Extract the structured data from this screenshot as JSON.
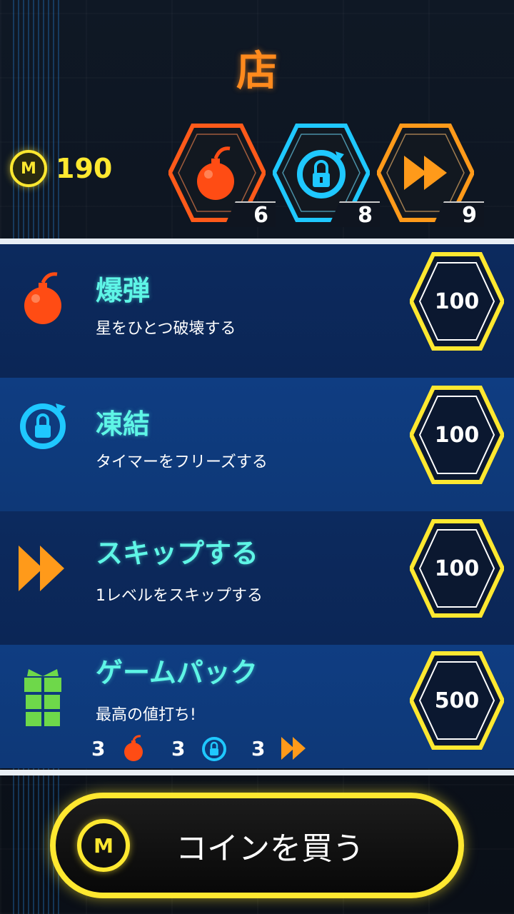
{
  "header": {
    "title": "店",
    "coin_symbol": "M",
    "coin_balance": "190"
  },
  "inventory": [
    {
      "name": "bomb",
      "count": "6",
      "color": "#ff5a1a"
    },
    {
      "name": "freeze",
      "count": "8",
      "color": "#1fc8ff"
    },
    {
      "name": "skip",
      "count": "9",
      "color": "#ff9a1a"
    }
  ],
  "items": [
    {
      "name": "爆弾",
      "desc": "星をひとつ破壊する",
      "price": "100"
    },
    {
      "name": "凍結",
      "desc": "タイマーをフリーズする",
      "price": "100"
    },
    {
      "name": "スキップする",
      "desc": "1レベルをスキップする",
      "price": "100"
    },
    {
      "name": "ゲームパック",
      "desc": "最高の値打ち!",
      "price": "500"
    }
  ],
  "pack_contents": [
    {
      "count": "3",
      "icon": "bomb-icon"
    },
    {
      "count": "3",
      "icon": "freeze-icon"
    },
    {
      "count": "3",
      "icon": "skip-icon"
    }
  ],
  "buy_coins": {
    "label": "コインを買う",
    "coin_symbol": "M"
  },
  "colors": {
    "accent_yellow": "#ffe830",
    "title_orange": "#ff8a1d",
    "item_name_cyan": "#5ef5e6"
  }
}
